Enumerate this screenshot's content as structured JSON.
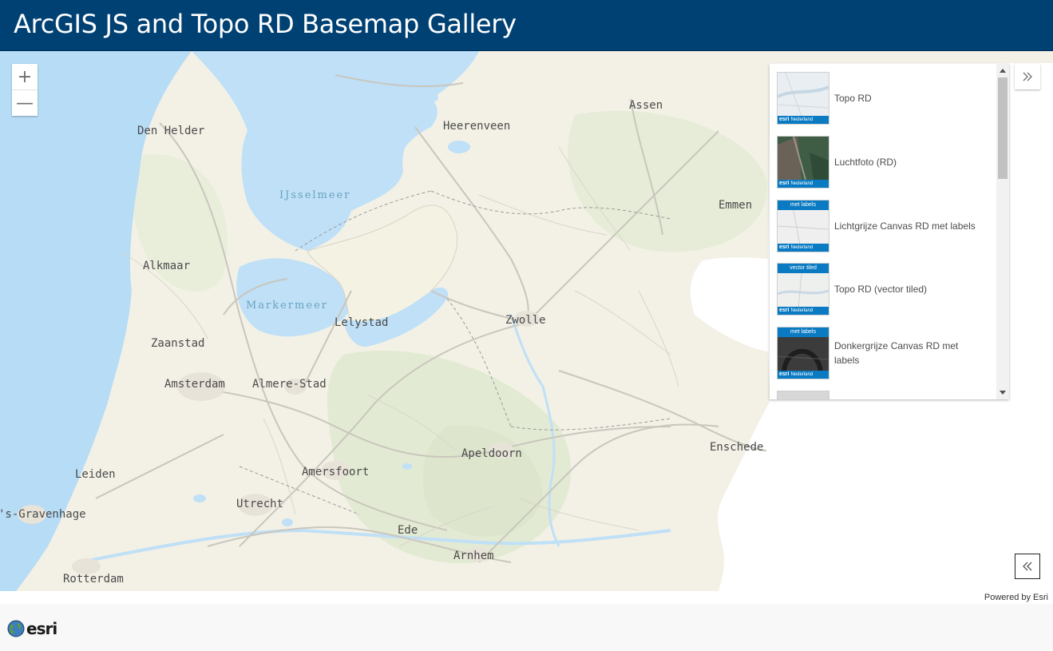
{
  "header": {
    "title": "ArcGIS JS and Topo RD Basemap Gallery"
  },
  "zoom": {
    "in_label": "+",
    "out_label": "—"
  },
  "map": {
    "place_labels": [
      {
        "name": "Den Helder"
      },
      {
        "name": "Heerenveen"
      },
      {
        "name": "Assen"
      },
      {
        "name": "Emmen"
      },
      {
        "name": "Alkmaar"
      },
      {
        "name": "Lelystad"
      },
      {
        "name": "Zwolle"
      },
      {
        "name": "Zaanstad"
      },
      {
        "name": "Amsterdam"
      },
      {
        "name": "Almere-Stad"
      },
      {
        "name": "Apeldoorn"
      },
      {
        "name": "Enschede"
      },
      {
        "name": "Amersfoort"
      },
      {
        "name": "Leiden"
      },
      {
        "name": "Utrecht"
      },
      {
        "name": "'s-Gravenhage"
      },
      {
        "name": "Ede"
      },
      {
        "name": "Arnhem"
      },
      {
        "name": "Rotterdam"
      }
    ],
    "water_labels": [
      {
        "name": "IJsselmeer"
      },
      {
        "name": "Markermeer"
      }
    ],
    "colors": {
      "land": "#f3f1e6",
      "water": "#bfe0f7",
      "sea": "#b6dcf6",
      "green": "#e3ead3",
      "road": "#c9c6bd"
    }
  },
  "gallery": {
    "items": [
      {
        "label": "Topo RD",
        "thumb_top": "",
        "thumb_style": "topo",
        "selected": true
      },
      {
        "label": "Luchtfoto (RD)",
        "thumb_top": "",
        "thumb_style": "aerial",
        "selected": false
      },
      {
        "label": "Lichtgrijze Canvas RD met labels",
        "thumb_top": "met labels",
        "thumb_style": "light",
        "selected": false
      },
      {
        "label": "Topo RD (vector tiled)",
        "thumb_top": "vector tiled",
        "thumb_style": "topo",
        "selected": false
      },
      {
        "label": "Donkergrijze Canvas RD met labels",
        "thumb_top": "met labels",
        "thumb_style": "dark",
        "selected": false
      }
    ],
    "thumb_brand": "esri",
    "thumb_region": "Nederland"
  },
  "buttons": {
    "expand_icon": "double-chevron-right-icon",
    "collapse_icon": "double-chevron-left-icon"
  },
  "attribution": {
    "powered_by": "Powered by Esri"
  },
  "footer": {
    "logo_text": "esri",
    "logo_icon": "globe-icon"
  }
}
